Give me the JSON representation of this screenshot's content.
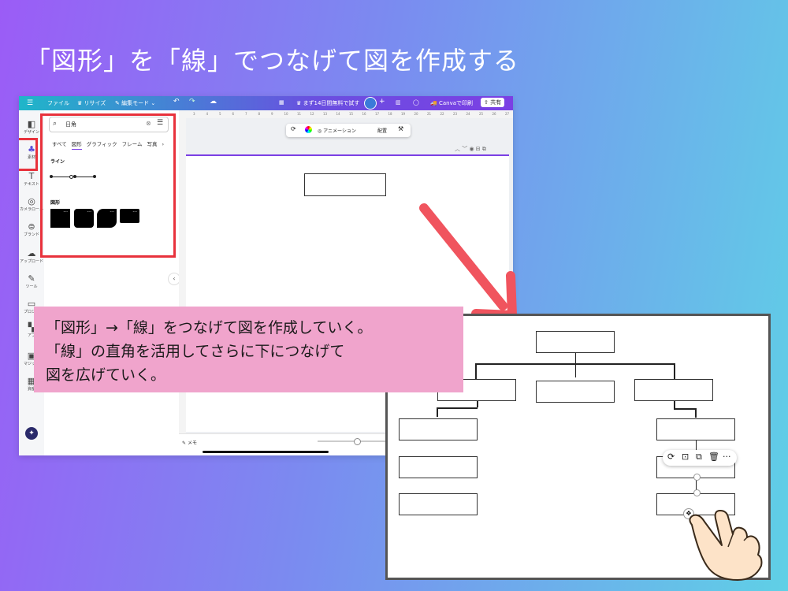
{
  "title": "「図形」を「線」でつなげて図を作成する",
  "canva": {
    "topbar": {
      "file": "ファイル",
      "resize": "リサイズ",
      "mode": "編集モード",
      "trial": "まず14日間無料で試す",
      "print": "Canvaで印刷",
      "share": "共有"
    },
    "rail": {
      "design": "デザイン",
      "elements": "素材",
      "text": "テキスト",
      "camera": "カメラロール",
      "brand": "ブランド",
      "upload": "アップロード",
      "tools": "ツール",
      "projects": "プロジェ",
      "apps": "アプ",
      "magic": "マジック",
      "assets": "資産"
    },
    "search": {
      "value": "日角"
    },
    "tabs": [
      "すべて",
      "図形",
      "グラフィック",
      "フレーム",
      "写真"
    ],
    "section_lines": "ライン",
    "section_shapes": "図形",
    "ruler_ticks": [
      "3",
      "4",
      "5",
      "6",
      "7",
      "8",
      "9",
      "10",
      "11",
      "12",
      "13",
      "14",
      "15",
      "16",
      "17",
      "18",
      "19",
      "20",
      "21",
      "22",
      "23",
      "24",
      "25",
      "26",
      "27"
    ],
    "float_toolbar": {
      "animation": "アニメーション",
      "arrange": "配置"
    },
    "memo": "メモ"
  },
  "callout": {
    "line1": "「図形」→「線」をつなげて図を作成していく。",
    "line2": "「線」の直角を活用してさらに下につなげて",
    "line3": "図を広げていく。"
  },
  "colors": {
    "highlight": "#e8323c",
    "arrow": "#f0545e",
    "callout_bg": "#f0a4cc",
    "accent": "#7b3fe4"
  }
}
